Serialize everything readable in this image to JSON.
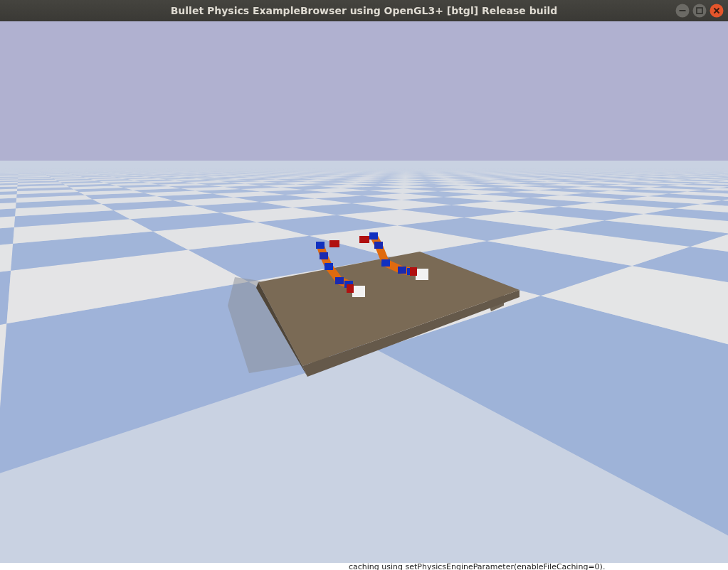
{
  "window": {
    "title": "Bullet Physics ExampleBrowser using OpenGL3+ [btgl] Release build"
  },
  "background_window": {
    "text": "caching using setPhysicsEngineParameter(enableFileCaching=0)."
  }
}
